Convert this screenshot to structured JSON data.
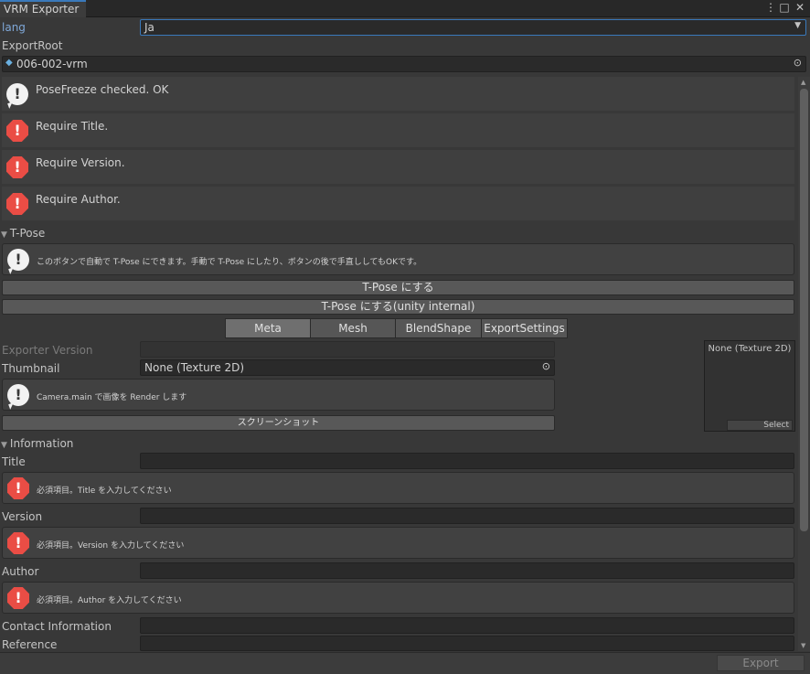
{
  "window": {
    "tab_title": "VRM Exporter"
  },
  "lang": {
    "label": "lang",
    "value": "Ja"
  },
  "export_root": {
    "label": "ExportRoot",
    "value": "006-002-vrm"
  },
  "validations": [
    {
      "type": "info",
      "text": "PoseFreeze checked. OK"
    },
    {
      "type": "error",
      "text": "Require Title."
    },
    {
      "type": "error",
      "text": "Require Version."
    },
    {
      "type": "error",
      "text": "Require Author."
    }
  ],
  "tpose": {
    "header": "T-Pose",
    "help": "このボタンで自動で T-Pose にできます。手動で T-Pose にしたり、ボタンの後で手直ししてもOKです。",
    "button1": "T-Pose にする",
    "button2": "T-Pose にする(unity internal)"
  },
  "tabs": [
    {
      "label": "Meta"
    },
    {
      "label": "Mesh"
    },
    {
      "label": "BlendShape"
    },
    {
      "label": "ExportSettings"
    }
  ],
  "meta": {
    "exporter_version_label": "Exporter Version",
    "thumbnail_label": "Thumbnail",
    "thumbnail_value": "None (Texture 2D)",
    "thumbnail_help": "Camera.main で画像を Render します",
    "screenshot_button": "スクリーンショット",
    "preview_label": "None (Texture 2D)",
    "preview_select": "Select"
  },
  "information": {
    "header": "Information",
    "title_label": "Title",
    "title_error": "必須項目。Title を入力してください",
    "version_label": "Version",
    "version_error": "必須項目。Version を入力してください",
    "author_label": "Author",
    "author_error": "必須項目。Author を入力してください",
    "contact_label": "Contact Information",
    "reference_label": "Reference"
  },
  "footer": {
    "export_button": "Export"
  },
  "colors": {
    "accent": "#3a79bb",
    "error": "#ea4d45",
    "info": "#f2f2f2"
  }
}
